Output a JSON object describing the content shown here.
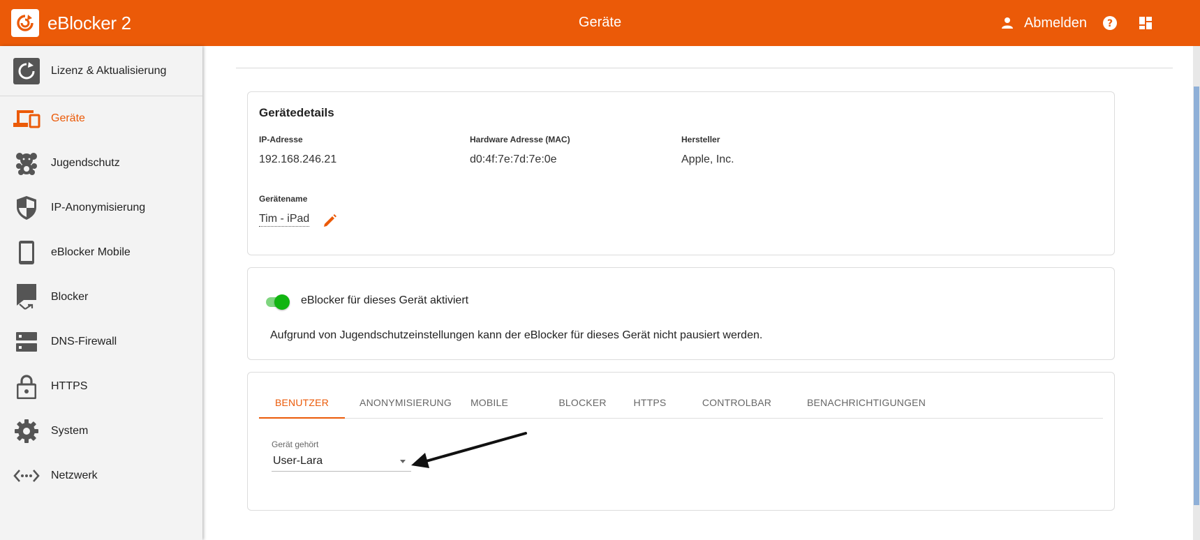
{
  "header": {
    "app_name": "eBlocker 2",
    "page_title": "Geräte",
    "logout_label": "Abmelden",
    "brand_color": "#eb5a08",
    "icons": [
      "eblocker-logo-icon",
      "person-icon",
      "help-icon",
      "dashboard-icon"
    ]
  },
  "sidebar": {
    "items": [
      {
        "label": "Lizenz & Aktualisierung",
        "icon": "license-refresh-icon",
        "active": false
      },
      {
        "label": "Geräte",
        "icon": "devices-icon",
        "active": true
      },
      {
        "label": "Jugendschutz",
        "icon": "teddy-bear-icon",
        "active": false
      },
      {
        "label": "IP-Anonymisierung",
        "icon": "shield-icon",
        "active": false
      },
      {
        "label": "eBlocker Mobile",
        "icon": "phone-icon",
        "active": false
      },
      {
        "label": "Blocker",
        "icon": "blocker-icon",
        "active": false
      },
      {
        "label": "DNS-Firewall",
        "icon": "dns-server-icon",
        "active": false
      },
      {
        "label": "HTTPS",
        "icon": "lock-icon",
        "active": false
      },
      {
        "label": "System",
        "icon": "gear-icon",
        "active": false
      },
      {
        "label": "Netzwerk",
        "icon": "network-icon",
        "active": false
      }
    ]
  },
  "device_details": {
    "title": "Gerätedetails",
    "ip_label": "IP-Adresse",
    "ip_value": "192.168.246.21",
    "mac_label": "Hardware Adresse (MAC)",
    "mac_value": "d0:4f:7e:7d:7e:0e",
    "vendor_label": "Hersteller",
    "vendor_value": "Apple, Inc.",
    "name_label": "Gerätename",
    "name_value": "Tim - iPad"
  },
  "activation": {
    "toggle_label": "eBlocker für dieses Gerät aktiviert",
    "toggle_on": true,
    "notice": "Aufgrund von Jugendschutzeinstellungen kann der eBlocker für dieses Gerät nicht pausiert werden."
  },
  "tabs": {
    "items": [
      "BENUTZER",
      "ANONYMISIERUNG",
      "MOBILE",
      "BLOCKER",
      "HTTPS",
      "CONTROLBAR",
      "BENACHRICHTIGUNGEN"
    ],
    "active": "BENUTZER"
  },
  "owner": {
    "label": "Gerät gehört",
    "value": "User-Lara"
  }
}
